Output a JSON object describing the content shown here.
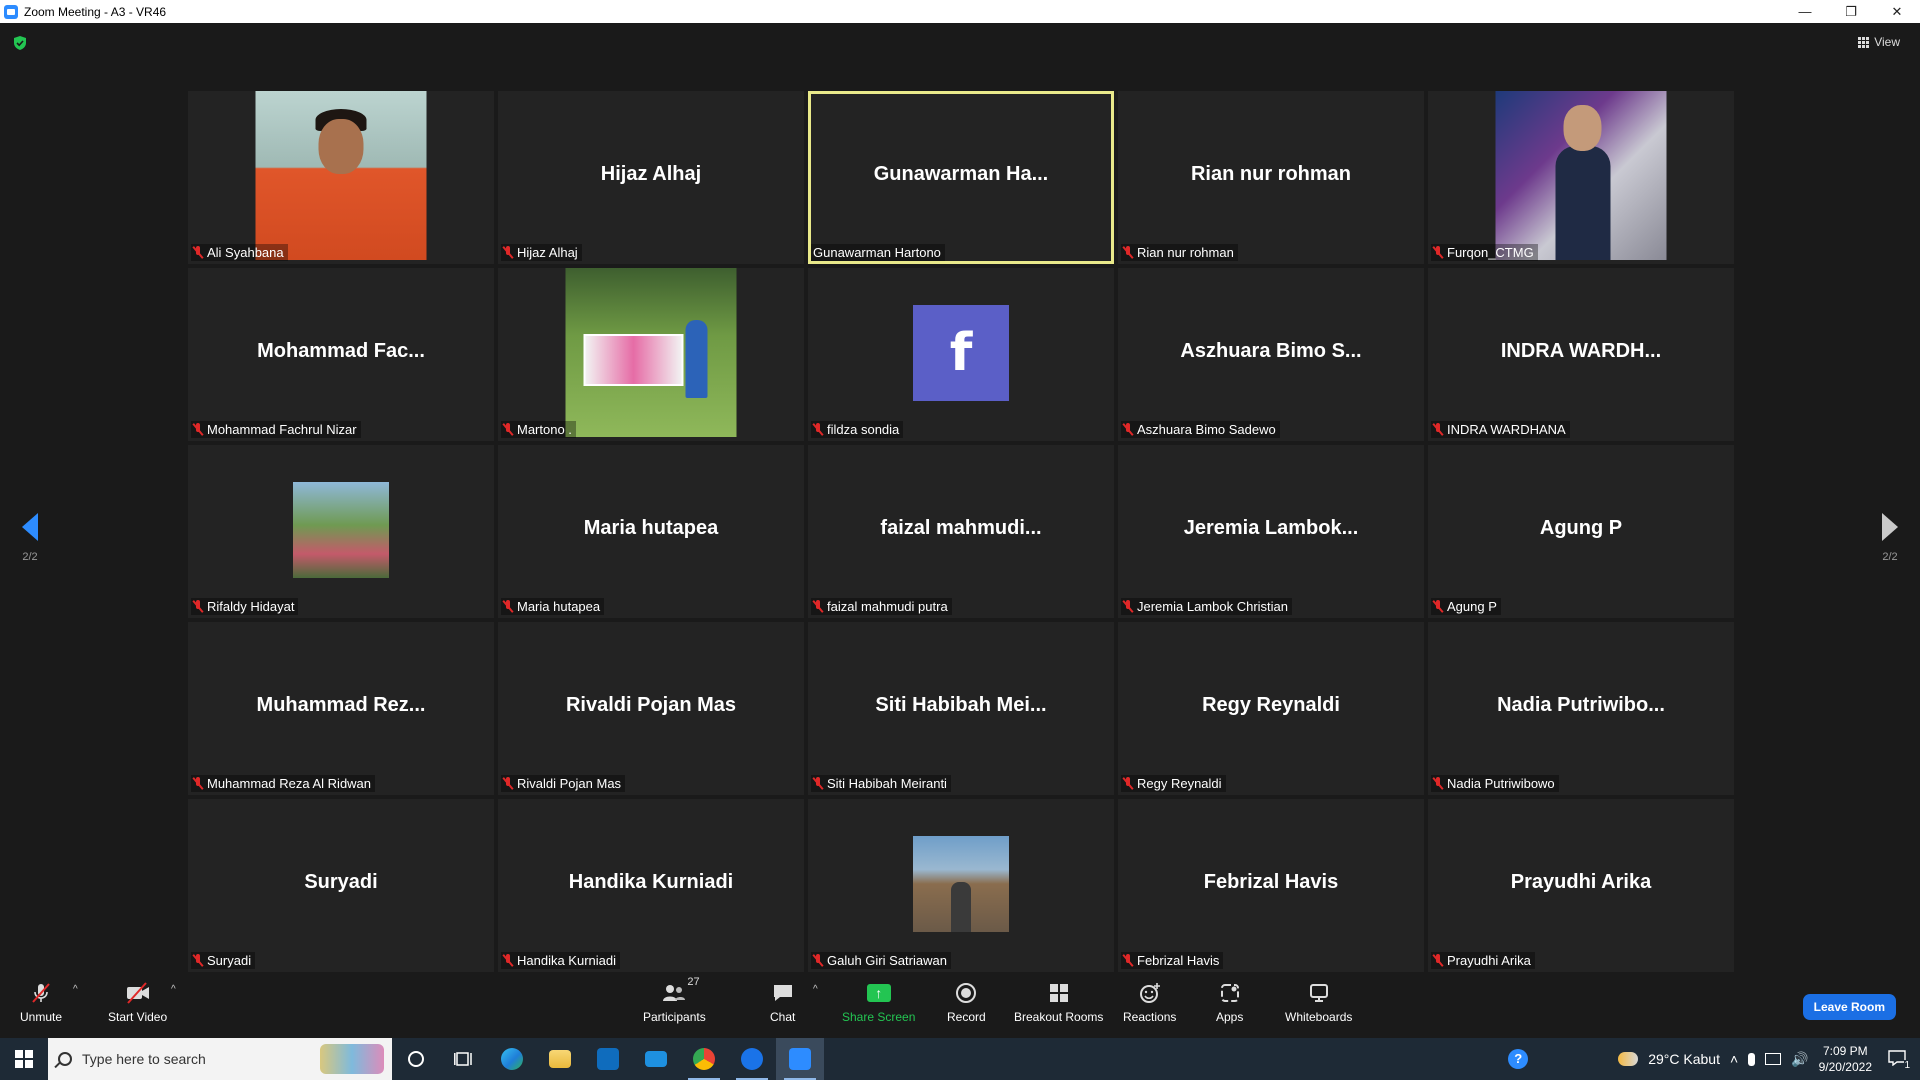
{
  "window": {
    "title": "Zoom Meeting - A3 - VR46",
    "minimize": "—",
    "restore": "❐",
    "close": "✕"
  },
  "view_button": {
    "label": "View"
  },
  "pager": {
    "left": "2/2",
    "right": "2/2"
  },
  "participants": [
    {
      "big": "",
      "label": "Ali Syahbana",
      "photo": "ali"
    },
    {
      "big": "Hijaz Alhaj",
      "label": "Hijaz Alhaj"
    },
    {
      "big": "Gunawarman  Ha...",
      "label": "Gunawarman Hartono",
      "active": true
    },
    {
      "big": "Rian nur rohman",
      "label": "Rian nur rohman"
    },
    {
      "big": "",
      "label": "Furqon_CTMG",
      "photo": "furqon"
    },
    {
      "big": "Mohammad  Fac...",
      "label": "Mohammad Fachrul Nizar"
    },
    {
      "big": "",
      "label": "Martono .",
      "photo": "martono"
    },
    {
      "big": "",
      "label": "fildza sondia",
      "photo": "fb"
    },
    {
      "big": "Aszhuara  Bimo  S...",
      "label": "Aszhuara Bimo Sadewo"
    },
    {
      "big": "INDRA  WARDH...",
      "label": "INDRA WARDHANA"
    },
    {
      "big": "",
      "label": "Rifaldy Hidayat",
      "photo": "rifaldy"
    },
    {
      "big": "Maria hutapea",
      "label": "Maria hutapea"
    },
    {
      "big": "faizal  mahmudi...",
      "label": "faizal mahmudi putra"
    },
    {
      "big": "Jeremia  Lambok...",
      "label": "Jeremia Lambok Christian"
    },
    {
      "big": "Agung P",
      "label": "Agung P"
    },
    {
      "big": "Muhammad  Rez...",
      "label": "Muhammad Reza Al Ridwan"
    },
    {
      "big": "Rivaldi Pojan Mas",
      "label": "Rivaldi Pojan Mas"
    },
    {
      "big": "Siti  Habibah  Mei...",
      "label": "Siti Habibah Meiranti"
    },
    {
      "big": "Regy Reynaldi",
      "label": "Regy Reynaldi"
    },
    {
      "big": "Nadia  Putriwibo...",
      "label": "Nadia Putriwibowo"
    },
    {
      "big": "Suryadi",
      "label": "Suryadi"
    },
    {
      "big": "Handika Kurniadi",
      "label": "Handika Kurniadi"
    },
    {
      "big": "",
      "label": "Galuh Giri Satriawan",
      "photo": "galuh"
    },
    {
      "big": "Febrizal Havis",
      "label": "Febrizal Havis"
    },
    {
      "big": "Prayudhi Arika",
      "label": "Prayudhi Arika"
    }
  ],
  "fb_letter": "f",
  "toolbar": {
    "unmute": "Unmute",
    "start_video": "Start Video",
    "participants": "Participants",
    "participants_count": "27",
    "chat": "Chat",
    "share_screen": "Share Screen",
    "record": "Record",
    "breakout_rooms": "Breakout Rooms",
    "reactions": "Reactions",
    "apps": "Apps",
    "whiteboards": "Whiteboards",
    "leave": "Leave Room",
    "caret": "^"
  },
  "taskbar": {
    "search_placeholder": "Type here to search",
    "weather": "29°C  Kabut",
    "time": "7:09 PM",
    "date": "9/20/2022",
    "notification_count": "1"
  },
  "colors": {
    "accent": "#2d8cff",
    "share": "#23c552",
    "active_outline": "#e9e98a",
    "muted": "#e02828",
    "leave": "#1b6fe4"
  }
}
